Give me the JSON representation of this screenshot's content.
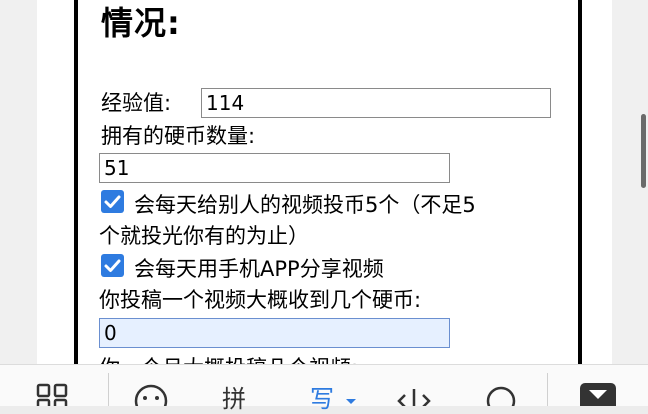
{
  "form": {
    "heading": "情况:",
    "exp_label": "经验值:",
    "exp_value": "114",
    "coins_label": "拥有的硬币数量:",
    "coins_value": "51",
    "checkbox1_line1": "会每天给别人的视频投币5个（不足5",
    "checkbox1_line2": "个就投光你有的为止）",
    "checkbox1_checked": true,
    "checkbox2_label": "会每天用手机APP分享视频",
    "checkbox2_checked": true,
    "upload_label": "你投稿一个视频大概收到几个硬币:",
    "upload_value": "0",
    "cutoff_label": "你一个月大概投稿几个视频:"
  },
  "keyboard": {
    "items": [
      {
        "name": "grid-icon"
      },
      {
        "name": "emoji-icon"
      },
      {
        "name": "pinyin",
        "label": "拼"
      },
      {
        "name": "handwriting",
        "label": "写"
      },
      {
        "name": "cursor-icon"
      },
      {
        "name": "search-icon"
      },
      {
        "name": "hide-keyboard-icon"
      }
    ],
    "accent": "#2e7be0"
  }
}
